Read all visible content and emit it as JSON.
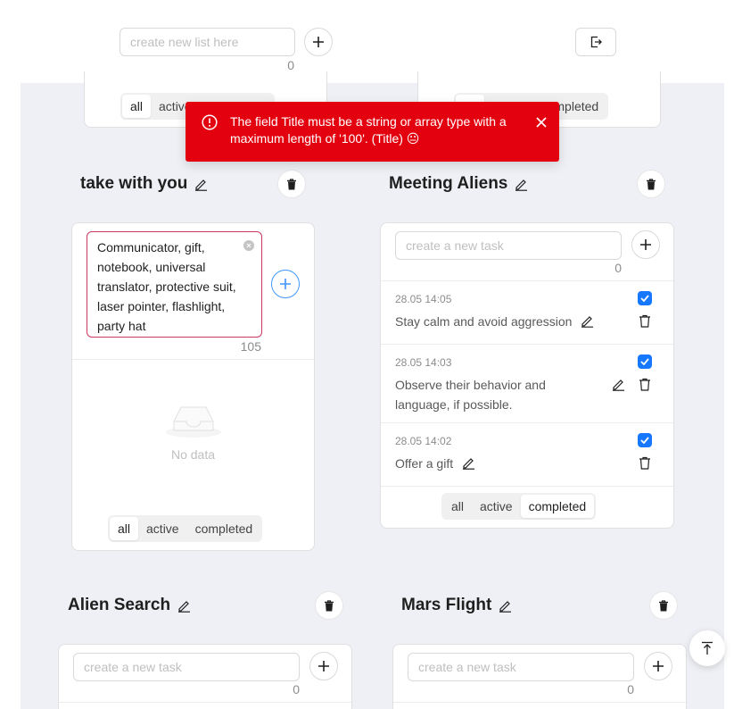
{
  "header": {
    "new_list_placeholder": "create new list here",
    "new_list_count": "0",
    "add_icon": "plus-icon",
    "logout_icon": "logout-icon"
  },
  "top_partial_lists": {
    "left_filter": {
      "all": "all",
      "active": "active"
    },
    "right_filter": {
      "completed": "completed"
    }
  },
  "toast": {
    "message": "The field Title must be a string or array type with a maximum length of '100'. (Title) 😐",
    "icon": "exclamation-circle-icon",
    "close_icon": "close-icon",
    "color": "#e3000f"
  },
  "lists": [
    {
      "title": "take with you",
      "input_value": "Communicator, gift, notebook, universal translator, protective suit, laser pointer, flashlight, party hat",
      "input_count": "105",
      "empty_text": "No data",
      "filters": [
        "all",
        "active",
        "completed"
      ],
      "selected_filter": "all"
    },
    {
      "title": "Meeting Aliens",
      "input_placeholder": "create a new task",
      "input_count": "0",
      "tasks": [
        {
          "date": "28.05 14:05",
          "text": "Stay calm and avoid aggression",
          "done": true
        },
        {
          "date": "28.05 14:03",
          "text": "Observe their behavior and language, if possible.",
          "done": true
        },
        {
          "date": "28.05 14:02",
          "text": "Offer a gift",
          "done": true
        }
      ],
      "filters": [
        "all",
        "active",
        "completed"
      ],
      "selected_filter": "completed"
    },
    {
      "title": "Alien Search",
      "input_placeholder": "create a new task",
      "input_count": "0"
    },
    {
      "title": "Mars Flight",
      "input_placeholder": "create a new task",
      "input_count": "0"
    }
  ],
  "back_to_top_icon": "vertical-align-top-icon",
  "accent_color": "#1677ff"
}
